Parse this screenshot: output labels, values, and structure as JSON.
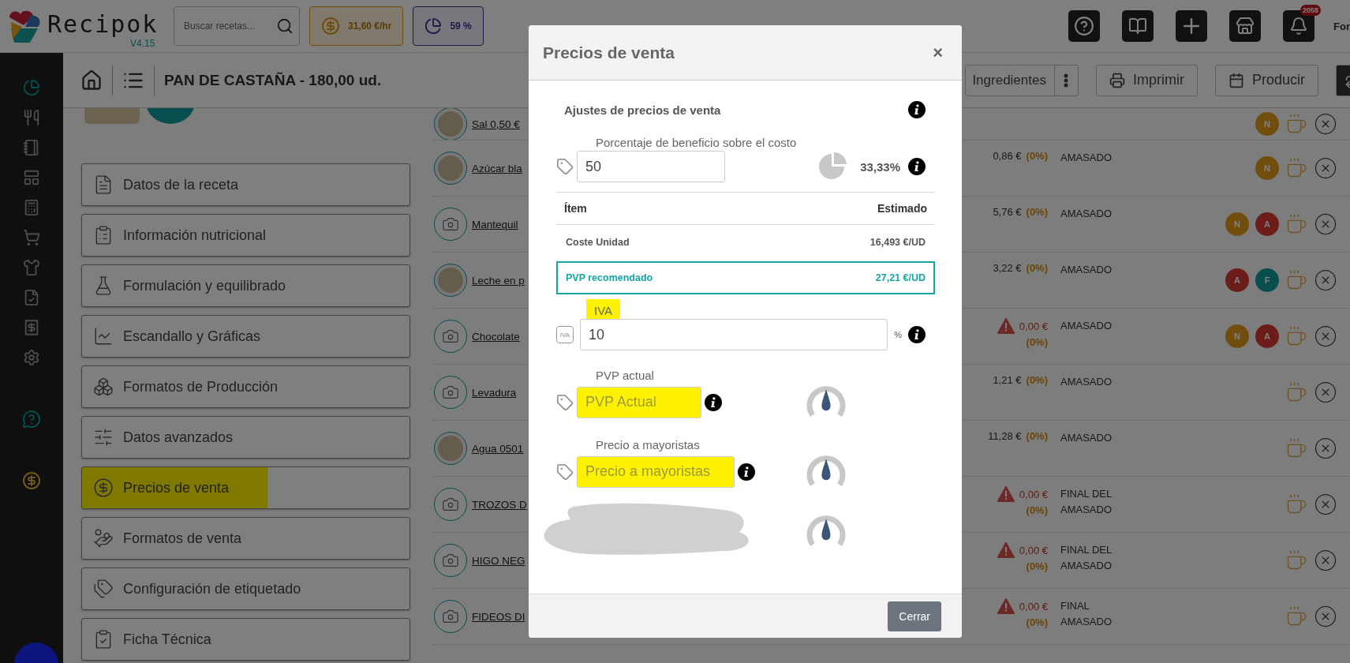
{
  "header": {
    "logo": "Recipok",
    "version": "V4.15",
    "search": {
      "placeholder": "Buscar recetas..."
    },
    "cost_badge": "31,60 €/hr",
    "progress_badge": "59 %",
    "notifications": "2058",
    "user": "For"
  },
  "toolbar": {
    "title": "PAN DE CASTAÑA - 180,00 ud.",
    "buttons": [
      {
        "kind": "text",
        "label": "Ingredientes"
      },
      {
        "kind": "more"
      },
      {
        "kind": "print",
        "label": "Imprimir"
      },
      {
        "kind": "produce",
        "label": "Producir"
      },
      {
        "kind": "dark"
      }
    ]
  },
  "menu": [
    {
      "label": "Datos de la receta",
      "highlighted": false
    },
    {
      "label": "Información nutricional",
      "highlighted": false
    },
    {
      "label": "Formulación y equilibrado",
      "highlighted": false
    },
    {
      "label": "Escandallo y Gráficas",
      "highlighted": false
    },
    {
      "label": "Formatos de Producción",
      "highlighted": false
    },
    {
      "label": "Datos avanzados",
      "highlighted": false
    },
    {
      "label": "Precios de venta",
      "highlighted": true
    },
    {
      "label": "Formatos de venta",
      "highlighted": false
    },
    {
      "label": "Configuración de etiquetado",
      "highlighted": false
    },
    {
      "label": "Ficha Técnica",
      "highlighted": false
    }
  ],
  "ingredients": [
    {
      "kind": "photo",
      "name": "Sal 0,50 €",
      "badges": [
        {
          "letter": "N",
          "color": "#724e0e"
        }
      ]
    },
    {
      "kind": "photo",
      "name": "Azúcar bla",
      "price": "0,86 €",
      "pct": "(0%)",
      "stage": "AMASADO",
      "warning": false,
      "badges": [
        {
          "letter": "N",
          "color": "#724e0e"
        }
      ]
    },
    {
      "kind": "camera",
      "name": "Mantequil",
      "price": "5,76 €",
      "pct": "(0%)",
      "stage": "AMASADO",
      "warning": false,
      "badges": [
        {
          "letter": "N",
          "color": "#724e0e"
        },
        {
          "letter": "A",
          "color": "#6d1d19"
        }
      ]
    },
    {
      "kind": "photo",
      "name": "Leche en p",
      "price": "3,22 €",
      "pct": "(0%)",
      "stage": "AMASADO",
      "warning": false,
      "badges": [
        {
          "letter": "A",
          "color": "#6d1d19"
        },
        {
          "letter": "F",
          "color": "#094e4e"
        }
      ]
    },
    {
      "kind": "camera",
      "name": "Chocolate",
      "price": "0,00 €",
      "pct": "(0%)",
      "stage": "AMASADO",
      "warning": true,
      "badges": [
        {
          "letter": "N",
          "color": "#724e0e"
        },
        {
          "letter": "A",
          "color": "#6d1d19"
        }
      ]
    },
    {
      "kind": "camera",
      "name": "Levadura",
      "price": "1,21 €",
      "pct": "(0%)",
      "stage": "AMASADO",
      "warning": false
    },
    {
      "kind": "photo",
      "name": "Agua 0501",
      "price": "11,28 €",
      "pct": "(0%)",
      "stage": "AMASADO",
      "warning": false
    },
    {
      "kind": "camera",
      "name": "TROZOS D",
      "price": "0,00 €",
      "pct": "(0%)",
      "stage": "FINAL DEL AMASADO",
      "warning": true
    },
    {
      "kind": "camera",
      "name": "HIGO NEG",
      "price": "0,00 €",
      "pct": "(0%)",
      "stage": "FINAL DEL AMASADO",
      "warning": true
    },
    {
      "kind": "camera",
      "name": "FIDEOS DI",
      "price": "0,00 €",
      "pct": "(0%)",
      "stage": "FINAL AMASADO",
      "warning": true
    }
  ],
  "modal": {
    "title": "Precios de venta",
    "close": "×",
    "section": "Ajustes de precios de venta",
    "profit": {
      "label": "Porcentaje de beneficio sobre el costo",
      "value": "50",
      "ratio": "33,33%"
    },
    "table": {
      "columns": [
        "Ítem",
        "Estimado"
      ],
      "rows": [
        {
          "item": "Coste Unidad",
          "value": "16,493 €/UD",
          "highlighted": false
        },
        {
          "item": "PVP recomendado",
          "value": "27,21 €/UD",
          "highlighted": true
        }
      ]
    },
    "iva": {
      "label": "IVA",
      "badge": "IVA",
      "value": "10",
      "unit": "%",
      "highlighted": true
    },
    "prices": [
      {
        "kind": "field",
        "label": "PVP actual",
        "placeholder": "PVP Actual",
        "highlighted": true
      },
      {
        "kind": "field",
        "label": "Precio a mayoristas",
        "placeholder": "Precio a mayoristas",
        "highlighted": true
      },
      {
        "kind": "redacted"
      }
    ],
    "close_button": "Cerrar"
  }
}
